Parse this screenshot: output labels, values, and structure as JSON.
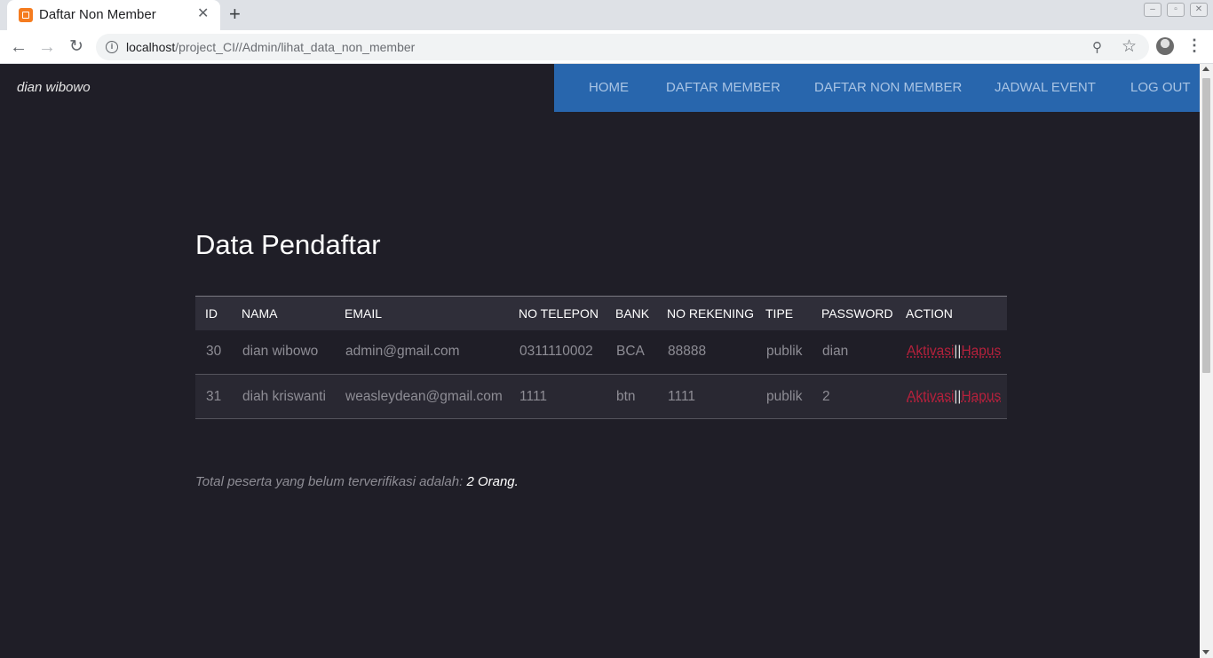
{
  "browser": {
    "tab_title": "Daftar Non Member",
    "url_host": "localhost",
    "url_path": "/project_CI//Admin/lihat_data_non_member"
  },
  "site": {
    "brand": "dian wibowo",
    "nav": [
      "HOME",
      "DAFTAR MEMBER",
      "DAFTAR NON MEMBER",
      "JADWAL EVENT",
      "LOG OUT"
    ]
  },
  "main": {
    "title": "Data Pendaftar",
    "table": {
      "headers": [
        "ID",
        "NAMA",
        "EMAIL",
        "NO TELEPON",
        "BANK",
        "NO REKENING",
        "TIPE",
        "PASSWORD",
        "ACTION"
      ],
      "rows": [
        {
          "id": "30",
          "nama": "dian wibowo",
          "email": "admin@gmail.com",
          "telepon": "0311110002",
          "bank": "BCA",
          "rekening": "88888",
          "tipe": "publik",
          "password": "dian"
        },
        {
          "id": "31",
          "nama": "diah kriswanti",
          "email": "weasleydean@gmail.com",
          "telepon": "1111",
          "bank": "btn",
          "rekening": "1111",
          "tipe": "publik",
          "password": "2"
        }
      ],
      "action_activate": "Aktivasi",
      "action_separator": "||",
      "action_delete": "Hapus"
    },
    "footer_text": "Total peserta yang belum terverifikasi adalah: ",
    "footer_count": "2 Orang."
  },
  "colors": {
    "page_bg": "#1f1e27",
    "navbar": "#2866ad",
    "action_link": "#b5213c"
  }
}
